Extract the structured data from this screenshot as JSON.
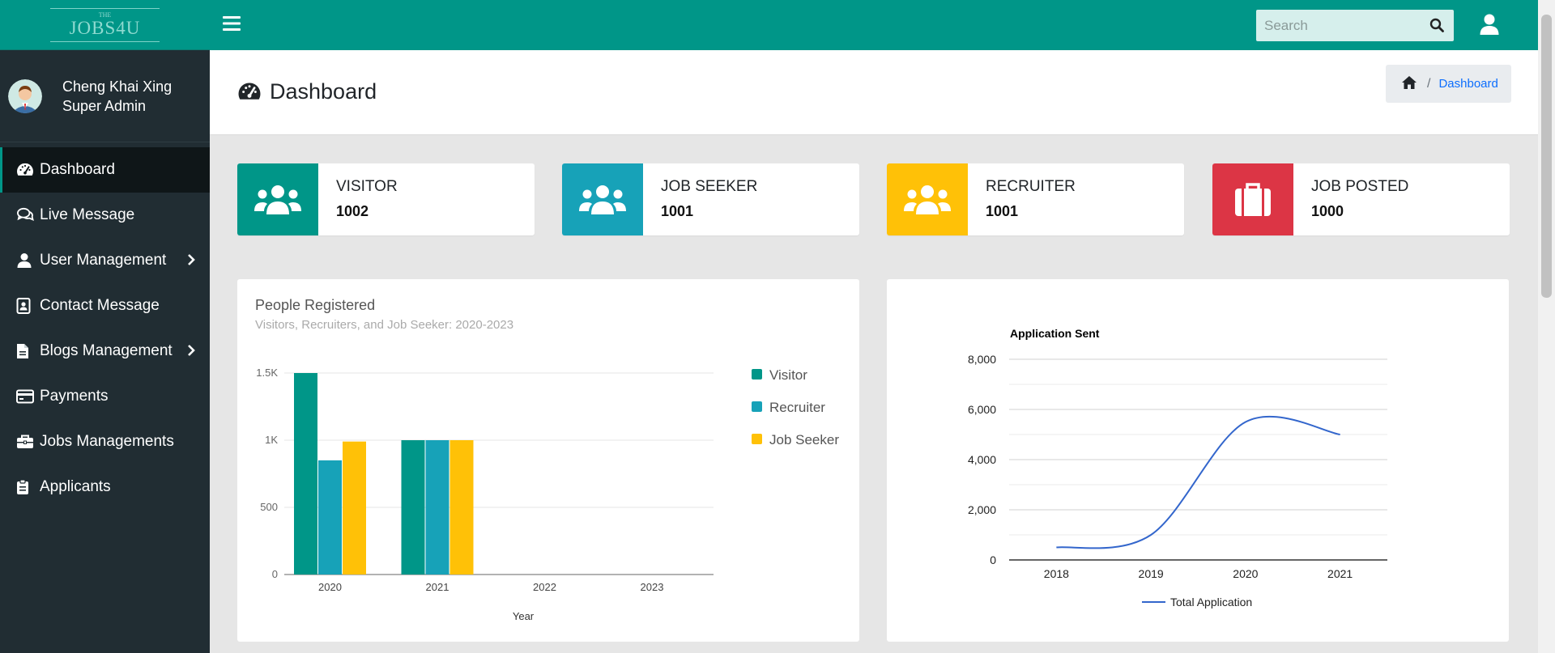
{
  "brand": {
    "small": "THE",
    "name": "JOBS4U"
  },
  "user": {
    "name": "Cheng Khai Xing",
    "role": "Super Admin"
  },
  "sidebar": {
    "items": [
      {
        "label": "Dashboard",
        "icon": "tachometer-icon",
        "active": true
      },
      {
        "label": "Live Message",
        "icon": "comments-icon"
      },
      {
        "label": "User Management",
        "icon": "user-icon",
        "has_submenu": true
      },
      {
        "label": "Contact Message",
        "icon": "address-book-icon"
      },
      {
        "label": "Blogs Management",
        "icon": "file-icon",
        "has_submenu": true
      },
      {
        "label": "Payments",
        "icon": "credit-card-icon"
      },
      {
        "label": "Jobs Managements",
        "icon": "briefcase-icon"
      },
      {
        "label": "Applicants",
        "icon": "clipboard-icon"
      }
    ]
  },
  "topbar": {
    "search_placeholder": "Search"
  },
  "page": {
    "title": "Dashboard"
  },
  "breadcrumb": {
    "current": "Dashboard"
  },
  "stats": [
    {
      "label": "VISITOR",
      "value": "1002",
      "color": "#009688",
      "icon": "users-icon"
    },
    {
      "label": "JOB SEEKER",
      "value": "1001",
      "color": "#17a2b8",
      "icon": "users-icon"
    },
    {
      "label": "RECRUITER",
      "value": "1001",
      "color": "#ffc107",
      "icon": "users-icon"
    },
    {
      "label": "JOB POSTED",
      "value": "1000",
      "color": "#dc3545",
      "icon": "suitcase-icon"
    }
  ],
  "colors": {
    "primary": "#009688",
    "sidebar": "#212d33",
    "info": "#17a2b8",
    "warning": "#ffc107",
    "danger": "#dc3545",
    "line": "#3366cc"
  },
  "chart_data": [
    {
      "type": "bar",
      "title": "People Registered",
      "subtitle": "Visitors, Recruiters, and Job Seeker: 2020-2023",
      "xlabel": "Year",
      "ylabel": "",
      "categories": [
        "2020",
        "2021",
        "2022",
        "2023"
      ],
      "series": [
        {
          "name": "Visitor",
          "values": [
            1500,
            1000,
            0,
            0
          ],
          "color": "#009688"
        },
        {
          "name": "Recruiter",
          "values": [
            850,
            1000,
            0,
            0
          ],
          "color": "#17a2b8"
        },
        {
          "name": "Job Seeker",
          "values": [
            990,
            1000,
            0,
            0
          ],
          "color": "#ffc107"
        }
      ],
      "ylim": [
        0,
        1500
      ],
      "yticks": [
        0,
        500,
        1000,
        1500
      ],
      "ytick_labels": [
        "0",
        "500",
        "1K",
        "1.5K"
      ],
      "grid": true,
      "legend": "right"
    },
    {
      "type": "line",
      "title": "Application Sent",
      "xlabel": "",
      "ylabel": "",
      "categories": [
        "2018",
        "2019",
        "2020",
        "2021"
      ],
      "series": [
        {
          "name": "Total Application",
          "values": [
            500,
            1000,
            5500,
            5000
          ],
          "color": "#3366cc"
        }
      ],
      "ylim": [
        0,
        8000
      ],
      "yticks": [
        0,
        2000,
        4000,
        6000,
        8000
      ],
      "ytick_labels": [
        "0",
        "2,000",
        "4,000",
        "6,000",
        "8,000"
      ],
      "grid": true,
      "legend": "bottom"
    }
  ]
}
